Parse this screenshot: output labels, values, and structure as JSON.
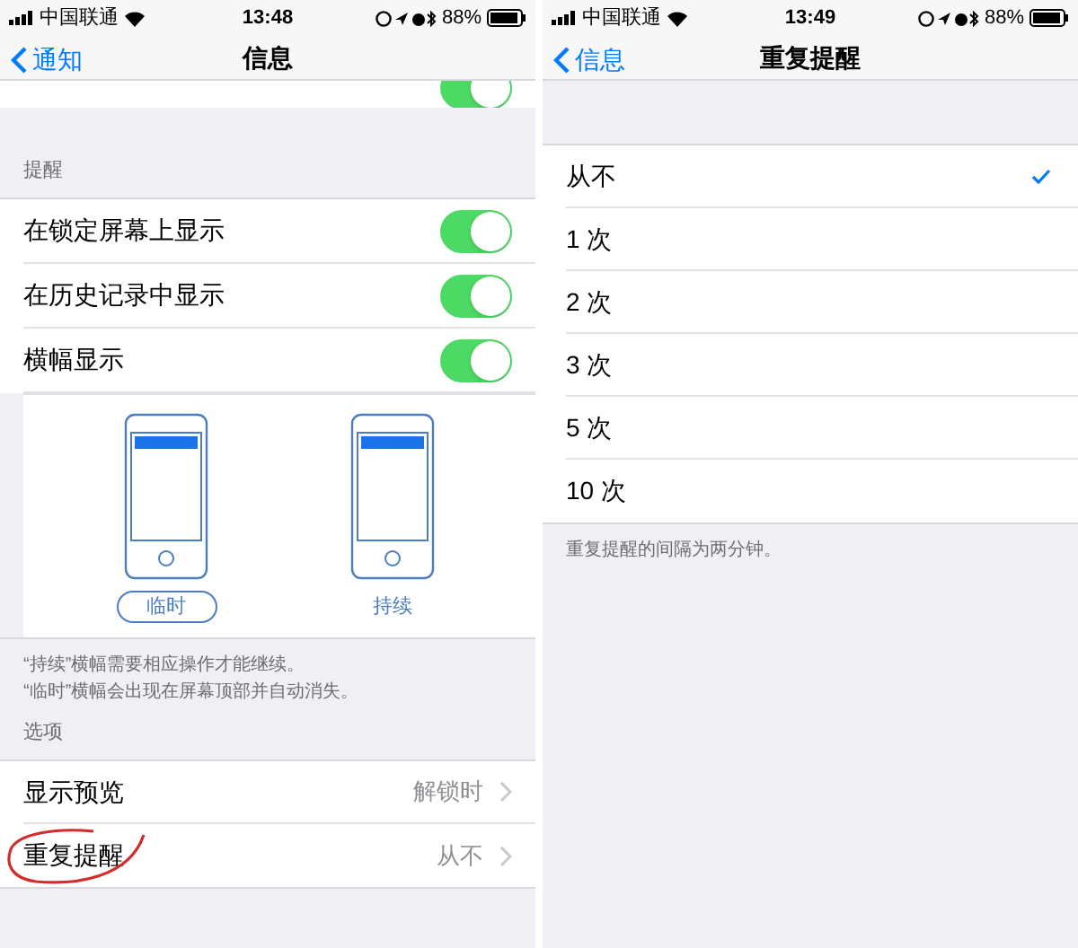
{
  "panels": [
    {
      "status_bar": {
        "carrier": "中国联通",
        "time": "13:48",
        "battery": "88%"
      },
      "nav": {
        "back": "通知",
        "title": "信息"
      },
      "top_row": {
        "on": true
      },
      "sections": [
        {
          "header": "提醒",
          "rows": [
            {
              "kind": "toggle",
              "label": "在锁定屏幕上显示",
              "on": true
            },
            {
              "kind": "toggle",
              "label": "在历史记录中显示",
              "on": true
            },
            {
              "kind": "toggle",
              "label": "横幅显示",
              "on": true
            }
          ],
          "banner_styles": [
            {
              "label": "临时",
              "selected": true
            },
            {
              "label": "持续",
              "selected": false
            }
          ],
          "footer": [
            "“持续”横幅需要相应操作才能继续。",
            "“临时”横幅会出现在屏幕顶部并自动消失。"
          ]
        },
        {
          "header": "选项",
          "rows": [
            {
              "kind": "link",
              "label": "显示预览",
              "value": "解锁时",
              "circled": false
            },
            {
              "kind": "link",
              "label": "重复提醒",
              "value": "从不",
              "circled": true
            }
          ]
        }
      ]
    },
    {
      "status_bar": {
        "carrier": "中国联通",
        "time": "13:49",
        "battery": "88%"
      },
      "nav": {
        "back": "信息",
        "title": "重复提醒"
      },
      "sections": [
        {
          "rows": [
            {
              "kind": "choice",
              "label": "从不",
              "selected": true
            },
            {
              "kind": "choice",
              "label": "1 次",
              "selected": false
            },
            {
              "kind": "choice",
              "label": "2 次",
              "selected": false
            },
            {
              "kind": "choice",
              "label": "3 次",
              "selected": false
            },
            {
              "kind": "choice",
              "label": "5 次",
              "selected": false
            },
            {
              "kind": "choice",
              "label": "10 次",
              "selected": false
            }
          ],
          "footer": [
            "重复提醒的间隔为两分钟。"
          ]
        }
      ]
    }
  ]
}
